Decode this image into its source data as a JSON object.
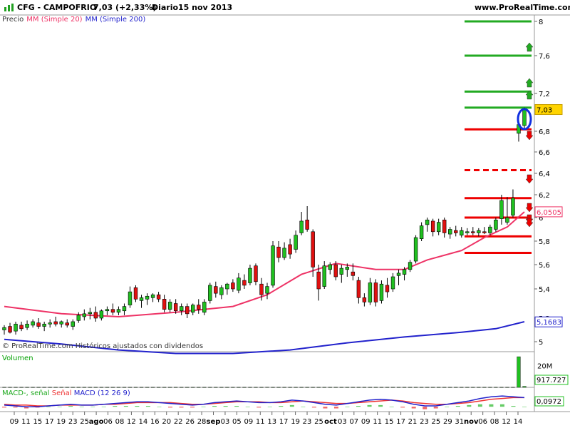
{
  "header": {
    "ticker": "CFG - CAMPOFRIO",
    "quote": "7,03 (+2,33%)",
    "period": "Diario",
    "date": "15 nov 2013",
    "site": "www.ProRealTime.com"
  },
  "legend": {
    "price": "Precio",
    "ma20": "MM (Simple 20)",
    "ma200": "MM (Simple 200)"
  },
  "watermark": "© ProRealTime.com  Históricos ajustados con dividendos",
  "volume_panel": {
    "label": "Volumen",
    "scale_label": "20M",
    "last_value": "917.727"
  },
  "macd_panel": {
    "label_macd": "MACD-, señal",
    "label_signal": "Señal",
    "label_main": "MACD (12 26 9)",
    "last_value": "0,0972"
  },
  "colors": {
    "up": "#20c020",
    "down": "#e01010",
    "ma20": "#ee3366",
    "ma200": "#2222cc",
    "hline_green": "#22aa22",
    "hline_red": "#ee0000",
    "last_badge": "#ffd400"
  },
  "chart_data": [
    {
      "type": "candlestick",
      "title": "CFG - CAMPOFRIO",
      "y_ticks": [
        "8",
        "7,6",
        "7,2",
        "6,8",
        "6,6",
        "6,4",
        "6,2",
        "6",
        "5,8",
        "5,6",
        "5,4",
        "5,2",
        "5"
      ],
      "y_tick_values": [
        8,
        7.6,
        7.2,
        6.8,
        6.6,
        6.4,
        6.2,
        6.0,
        5.8,
        5.6,
        5.4,
        5.2,
        5.0
      ],
      "x_ticks": [
        "09",
        "11",
        "15",
        "17",
        "19",
        "23",
        "25",
        "ago",
        "06",
        "08",
        "12",
        "14",
        "16",
        "20",
        "22",
        "26",
        "28",
        "sep",
        "03",
        "05",
        "09",
        "11",
        "13",
        "17",
        "19",
        "23",
        "25",
        "oct",
        "03",
        "07",
        "09",
        "11",
        "15",
        "17",
        "21",
        "23",
        "25",
        "29",
        "31",
        "nov",
        "06",
        "08",
        "12",
        "14"
      ],
      "last_price_label": "7,03",
      "last_price": 7.03,
      "ma20_label": "6,0505",
      "ma20_last": 6.0505,
      "ma200_label": "5,1683",
      "ma200_last": 5.1683,
      "candles": [
        {
          "o": 5.1,
          "h": 5.14,
          "l": 5.06,
          "c": 5.12
        },
        {
          "o": 5.13,
          "h": 5.16,
          "l": 5.07,
          "c": 5.08
        },
        {
          "o": 5.09,
          "h": 5.17,
          "l": 5.06,
          "c": 5.15
        },
        {
          "o": 5.14,
          "h": 5.17,
          "l": 5.09,
          "c": 5.11
        },
        {
          "o": 5.12,
          "h": 5.18,
          "l": 5.1,
          "c": 5.15
        },
        {
          "o": 5.14,
          "h": 5.19,
          "l": 5.12,
          "c": 5.17
        },
        {
          "o": 5.16,
          "h": 5.2,
          "l": 5.11,
          "c": 5.13
        },
        {
          "o": 5.13,
          "h": 5.17,
          "l": 5.09,
          "c": 5.15
        },
        {
          "o": 5.15,
          "h": 5.19,
          "l": 5.12,
          "c": 5.16
        },
        {
          "o": 5.17,
          "h": 5.21,
          "l": 5.13,
          "c": 5.15
        },
        {
          "o": 5.15,
          "h": 5.18,
          "l": 5.12,
          "c": 5.17
        },
        {
          "o": 5.16,
          "h": 5.19,
          "l": 5.12,
          "c": 5.14
        },
        {
          "o": 5.13,
          "h": 5.19,
          "l": 5.1,
          "c": 5.17
        },
        {
          "o": 5.18,
          "h": 5.24,
          "l": 5.16,
          "c": 5.22
        },
        {
          "o": 5.21,
          "h": 5.26,
          "l": 5.18,
          "c": 5.23
        },
        {
          "o": 5.23,
          "h": 5.27,
          "l": 5.19,
          "c": 5.24
        },
        {
          "o": 5.24,
          "h": 5.28,
          "l": 5.17,
          "c": 5.2
        },
        {
          "o": 5.2,
          "h": 5.26,
          "l": 5.18,
          "c": 5.25
        },
        {
          "o": 5.25,
          "h": 5.28,
          "l": 5.22,
          "c": 5.26
        },
        {
          "o": 5.26,
          "h": 5.3,
          "l": 5.22,
          "c": 5.24
        },
        {
          "o": 5.24,
          "h": 5.28,
          "l": 5.22,
          "c": 5.26
        },
        {
          "o": 5.25,
          "h": 5.3,
          "l": 5.22,
          "c": 5.28
        },
        {
          "o": 5.29,
          "h": 5.42,
          "l": 5.27,
          "c": 5.38
        },
        {
          "o": 5.41,
          "h": 5.43,
          "l": 5.31,
          "c": 5.33
        },
        {
          "o": 5.32,
          "h": 5.36,
          "l": 5.27,
          "c": 5.34
        },
        {
          "o": 5.33,
          "h": 5.37,
          "l": 5.29,
          "c": 5.35
        },
        {
          "o": 5.34,
          "h": 5.37,
          "l": 5.31,
          "c": 5.36
        },
        {
          "o": 5.36,
          "h": 5.38,
          "l": 5.31,
          "c": 5.33
        },
        {
          "o": 5.33,
          "h": 5.36,
          "l": 5.24,
          "c": 5.26
        },
        {
          "o": 5.26,
          "h": 5.33,
          "l": 5.24,
          "c": 5.31
        },
        {
          "o": 5.3,
          "h": 5.33,
          "l": 5.23,
          "c": 5.25
        },
        {
          "o": 5.25,
          "h": 5.3,
          "l": 5.22,
          "c": 5.28
        },
        {
          "o": 5.28,
          "h": 5.3,
          "l": 5.2,
          "c": 5.23
        },
        {
          "o": 5.24,
          "h": 5.3,
          "l": 5.22,
          "c": 5.29
        },
        {
          "o": 5.29,
          "h": 5.33,
          "l": 5.23,
          "c": 5.26
        },
        {
          "o": 5.24,
          "h": 5.33,
          "l": 5.22,
          "c": 5.31
        },
        {
          "o": 5.32,
          "h": 5.45,
          "l": 5.3,
          "c": 5.43
        },
        {
          "o": 5.42,
          "h": 5.46,
          "l": 5.34,
          "c": 5.37
        },
        {
          "o": 5.36,
          "h": 5.43,
          "l": 5.33,
          "c": 5.41
        },
        {
          "o": 5.4,
          "h": 5.45,
          "l": 5.36,
          "c": 5.44
        },
        {
          "o": 5.45,
          "h": 5.48,
          "l": 5.38,
          "c": 5.4
        },
        {
          "o": 5.39,
          "h": 5.53,
          "l": 5.37,
          "c": 5.49
        },
        {
          "o": 5.47,
          "h": 5.52,
          "l": 5.4,
          "c": 5.43
        },
        {
          "o": 5.45,
          "h": 5.6,
          "l": 5.43,
          "c": 5.57
        },
        {
          "o": 5.59,
          "h": 5.61,
          "l": 5.43,
          "c": 5.46
        },
        {
          "o": 5.44,
          "h": 5.49,
          "l": 5.32,
          "c": 5.36
        },
        {
          "o": 5.37,
          "h": 5.45,
          "l": 5.33,
          "c": 5.42
        },
        {
          "o": 5.43,
          "h": 5.8,
          "l": 5.41,
          "c": 5.76
        },
        {
          "o": 5.75,
          "h": 5.8,
          "l": 5.62,
          "c": 5.66
        },
        {
          "o": 5.66,
          "h": 5.79,
          "l": 5.64,
          "c": 5.74
        },
        {
          "o": 5.77,
          "h": 5.82,
          "l": 5.65,
          "c": 5.69
        },
        {
          "o": 5.73,
          "h": 5.89,
          "l": 5.7,
          "c": 5.85
        },
        {
          "o": 5.87,
          "h": 6.05,
          "l": 5.85,
          "c": 5.97
        },
        {
          "o": 5.98,
          "h": 6.1,
          "l": 5.88,
          "c": 5.9
        },
        {
          "o": 5.88,
          "h": 5.9,
          "l": 5.5,
          "c": 5.58
        },
        {
          "o": 5.54,
          "h": 5.6,
          "l": 5.32,
          "c": 5.4
        },
        {
          "o": 5.42,
          "h": 5.63,
          "l": 5.4,
          "c": 5.59
        },
        {
          "o": 5.56,
          "h": 5.62,
          "l": 5.52,
          "c": 5.6
        },
        {
          "o": 5.6,
          "h": 5.63,
          "l": 5.47,
          "c": 5.5
        },
        {
          "o": 5.52,
          "h": 5.6,
          "l": 5.45,
          "c": 5.57
        },
        {
          "o": 5.56,
          "h": 5.61,
          "l": 5.5,
          "c": 5.58
        },
        {
          "o": 5.54,
          "h": 5.61,
          "l": 5.47,
          "c": 5.51
        },
        {
          "o": 5.47,
          "h": 5.5,
          "l": 5.3,
          "c": 5.34
        },
        {
          "o": 5.34,
          "h": 5.37,
          "l": 5.28,
          "c": 5.31
        },
        {
          "o": 5.31,
          "h": 5.49,
          "l": 5.29,
          "c": 5.45
        },
        {
          "o": 5.45,
          "h": 5.48,
          "l": 5.28,
          "c": 5.31
        },
        {
          "o": 5.32,
          "h": 5.47,
          "l": 5.3,
          "c": 5.44
        },
        {
          "o": 5.43,
          "h": 5.49,
          "l": 5.34,
          "c": 5.38
        },
        {
          "o": 5.4,
          "h": 5.53,
          "l": 5.38,
          "c": 5.5
        },
        {
          "o": 5.51,
          "h": 5.56,
          "l": 5.43,
          "c": 5.53
        },
        {
          "o": 5.52,
          "h": 5.58,
          "l": 5.47,
          "c": 5.56
        },
        {
          "o": 5.56,
          "h": 5.64,
          "l": 5.54,
          "c": 5.62
        },
        {
          "o": 5.63,
          "h": 5.85,
          "l": 5.61,
          "c": 5.83
        },
        {
          "o": 5.82,
          "h": 5.96,
          "l": 5.8,
          "c": 5.93
        },
        {
          "o": 5.94,
          "h": 6.0,
          "l": 5.88,
          "c": 5.98
        },
        {
          "o": 5.97,
          "h": 5.99,
          "l": 5.84,
          "c": 5.88
        },
        {
          "o": 5.88,
          "h": 5.99,
          "l": 5.85,
          "c": 5.96
        },
        {
          "o": 5.98,
          "h": 6.0,
          "l": 5.83,
          "c": 5.87
        },
        {
          "o": 5.86,
          "h": 5.92,
          "l": 5.82,
          "c": 5.9
        },
        {
          "o": 5.89,
          "h": 5.93,
          "l": 5.84,
          "c": 5.87
        },
        {
          "o": 5.85,
          "h": 5.92,
          "l": 5.83,
          "c": 5.89
        },
        {
          "o": 5.87,
          "h": 5.91,
          "l": 5.85,
          "c": 5.88
        },
        {
          "o": 5.88,
          "h": 5.92,
          "l": 5.85,
          "c": 5.87
        },
        {
          "o": 5.87,
          "h": 5.91,
          "l": 5.84,
          "c": 5.89
        },
        {
          "o": 5.88,
          "h": 5.92,
          "l": 5.86,
          "c": 5.87
        },
        {
          "o": 5.87,
          "h": 5.94,
          "l": 5.85,
          "c": 5.92
        },
        {
          "o": 5.9,
          "h": 6.0,
          "l": 5.88,
          "c": 5.98
        },
        {
          "o": 5.99,
          "h": 6.2,
          "l": 5.94,
          "c": 6.15
        },
        {
          "o": 5.96,
          "h": 6.18,
          "l": 5.94,
          "c": 6.0
        },
        {
          "o": 6.02,
          "h": 6.25,
          "l": 6.0,
          "c": 6.17
        },
        {
          "o": 6.78,
          "h": 6.97,
          "l": 6.7,
          "c": 6.87
        },
        {
          "o": 6.86,
          "h": 7.05,
          "l": 6.82,
          "c": 7.03
        }
      ],
      "ma20": [
        {
          "i": 0,
          "v": 5.28
        },
        {
          "i": 10,
          "v": 5.23
        },
        {
          "i": 20,
          "v": 5.21
        },
        {
          "i": 30,
          "v": 5.24
        },
        {
          "i": 40,
          "v": 5.28
        },
        {
          "i": 46,
          "v": 5.36
        },
        {
          "i": 52,
          "v": 5.52
        },
        {
          "i": 58,
          "v": 5.61
        },
        {
          "i": 65,
          "v": 5.56
        },
        {
          "i": 70,
          "v": 5.56
        },
        {
          "i": 74,
          "v": 5.64
        },
        {
          "i": 80,
          "v": 5.72
        },
        {
          "i": 84,
          "v": 5.83
        },
        {
          "i": 88,
          "v": 5.92
        },
        {
          "i": 91,
          "v": 6.05
        }
      ],
      "ma200": [
        {
          "i": 0,
          "v": 5.02
        },
        {
          "i": 10,
          "v": 4.98
        },
        {
          "i": 20,
          "v": 4.93
        },
        {
          "i": 30,
          "v": 4.9
        },
        {
          "i": 40,
          "v": 4.9
        },
        {
          "i": 50,
          "v": 4.93
        },
        {
          "i": 60,
          "v": 4.99
        },
        {
          "i": 70,
          "v": 5.04
        },
        {
          "i": 80,
          "v": 5.08
        },
        {
          "i": 86,
          "v": 5.11
        },
        {
          "i": 91,
          "v": 5.17
        }
      ],
      "support_resistance": [
        {
          "level": 8.0,
          "color": "green",
          "style": "solid"
        },
        {
          "level": 7.6,
          "color": "green",
          "style": "solid"
        },
        {
          "level": 7.22,
          "color": "green",
          "style": "solid"
        },
        {
          "level": 7.05,
          "color": "green",
          "style": "solid"
        },
        {
          "level": 6.82,
          "color": "red",
          "style": "solid"
        },
        {
          "level": 6.43,
          "color": "red",
          "style": "dashed"
        },
        {
          "level": 6.17,
          "color": "red",
          "style": "solid"
        },
        {
          "level": 6.0,
          "color": "red",
          "style": "solid"
        },
        {
          "level": 5.84,
          "color": "red",
          "style": "solid"
        },
        {
          "level": 5.7,
          "color": "red",
          "style": "solid"
        }
      ]
    },
    {
      "type": "bar",
      "title": "Volumen",
      "y_ticks": [
        "20M"
      ],
      "values_M": [
        0.1,
        0.1,
        0.1,
        0.1,
        0.1,
        0.1,
        0.1,
        0.1,
        0.1,
        0.1,
        0.1,
        0.1,
        0.1,
        0.1,
        0.1,
        0.1,
        0.1,
        0.1,
        0.1,
        0.1,
        0.1,
        0.1,
        0.1,
        0.1,
        0.1,
        0.1,
        0.1,
        0.1,
        0.1,
        0.1,
        0.1,
        0.1,
        0.1,
        0.1,
        0.1,
        0.1,
        0.1,
        0.1,
        0.1,
        0.1,
        0.1,
        0.1,
        0.1,
        0.1,
        0.1,
        0.1,
        0.2,
        0.1,
        0.1,
        0.1,
        0.1,
        0.1,
        0.1,
        0.1,
        0.1,
        0.1,
        0.1,
        0.1,
        0.1,
        0.1,
        0.1,
        0.1,
        0.1,
        0.1,
        0.1,
        0.1,
        0.1,
        0.1,
        0.1,
        0.1,
        0.1,
        0.1,
        0.1,
        0.1,
        0.1,
        0.1,
        0.1,
        0.1,
        0.1,
        0.1,
        0.1,
        0.1,
        0.1,
        0.1,
        0.1,
        0.1,
        0.1,
        0.1,
        0.1,
        0.1,
        28.0,
        0.917727
      ],
      "ylim": [
        0,
        30
      ]
    },
    {
      "type": "line",
      "title": "MACD (12 26 9)",
      "macd": [
        0.02,
        0.01,
        0.0,
        0.0,
        0.01,
        0.02,
        0.03,
        0.02,
        0.02,
        0.03,
        0.04,
        0.05,
        0.06,
        0.06,
        0.05,
        0.04,
        0.03,
        0.02,
        0.03,
        0.05,
        0.06,
        0.07,
        0.06,
        0.05,
        0.05,
        0.06,
        0.08,
        0.07,
        0.05,
        0.03,
        0.02,
        0.04,
        0.06,
        0.08,
        0.09,
        0.08,
        0.06,
        0.03,
        0.01,
        0.01,
        0.03,
        0.05,
        0.07,
        0.1,
        0.12,
        0.13,
        0.12,
        0.11
      ],
      "signal": [
        0.03,
        0.02,
        0.02,
        0.01,
        0.01,
        0.02,
        0.02,
        0.02,
        0.02,
        0.03,
        0.03,
        0.04,
        0.05,
        0.05,
        0.05,
        0.05,
        0.04,
        0.03,
        0.03,
        0.04,
        0.05,
        0.06,
        0.06,
        0.06,
        0.05,
        0.05,
        0.06,
        0.07,
        0.06,
        0.05,
        0.04,
        0.04,
        0.05,
        0.06,
        0.07,
        0.08,
        0.07,
        0.05,
        0.04,
        0.03,
        0.03,
        0.04,
        0.05,
        0.07,
        0.09,
        0.1,
        0.11,
        0.11
      ],
      "ylim": [
        -0.05,
        0.2
      ]
    }
  ]
}
